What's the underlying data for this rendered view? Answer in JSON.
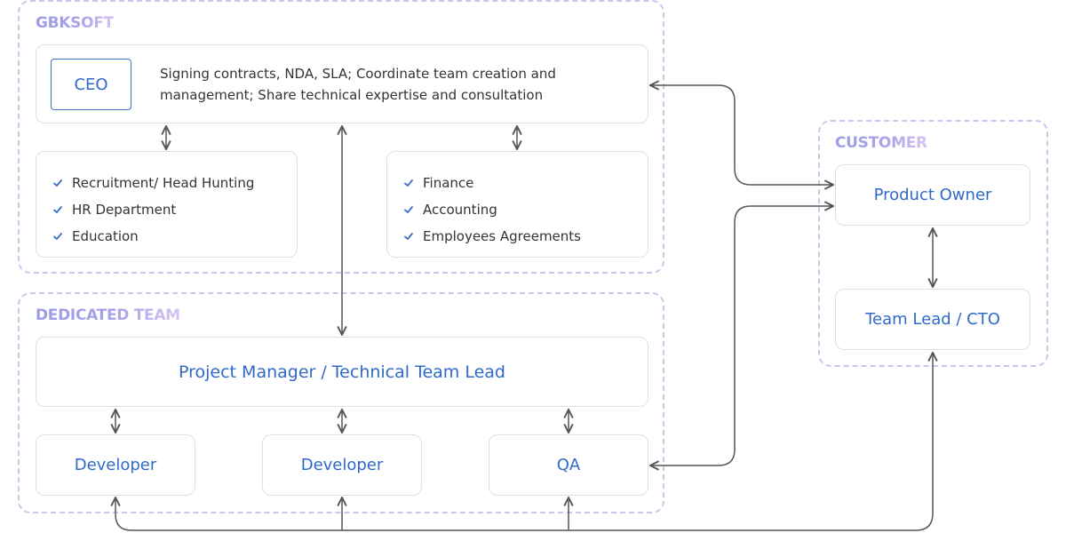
{
  "groups": {
    "company": {
      "title": "GBKSOFT"
    },
    "team": {
      "title": "DEDICATED TEAM"
    },
    "customer": {
      "title": "CUSTOMER"
    }
  },
  "ceo": {
    "label": "CEO",
    "description": "Signing contracts, NDA, SLA; Coordinate team creation and management; Share technical expertise and consultation"
  },
  "hr_card": {
    "items": [
      "Recruitment/ Head Hunting",
      "HR Department",
      "Education"
    ]
  },
  "finance_card": {
    "items": [
      "Finance",
      "Accounting",
      "Employees Agreements"
    ]
  },
  "team": {
    "lead": "Project Manager / Technical Team Lead",
    "members": [
      "Developer",
      "Developer",
      "QA"
    ]
  },
  "customer": {
    "product_owner": "Product Owner",
    "cto": "Team Lead / CTO"
  },
  "colors": {
    "accent_text": "#2f6ac9",
    "group_border": "#c9c8ec",
    "heading_gradient_start": "#9d9ce8",
    "heading_gradient_end": "#d6c4f0",
    "connector": "#555555",
    "check": "#3d70c6"
  },
  "icons": {
    "check": "check-icon",
    "arrow": "arrow-icon"
  }
}
